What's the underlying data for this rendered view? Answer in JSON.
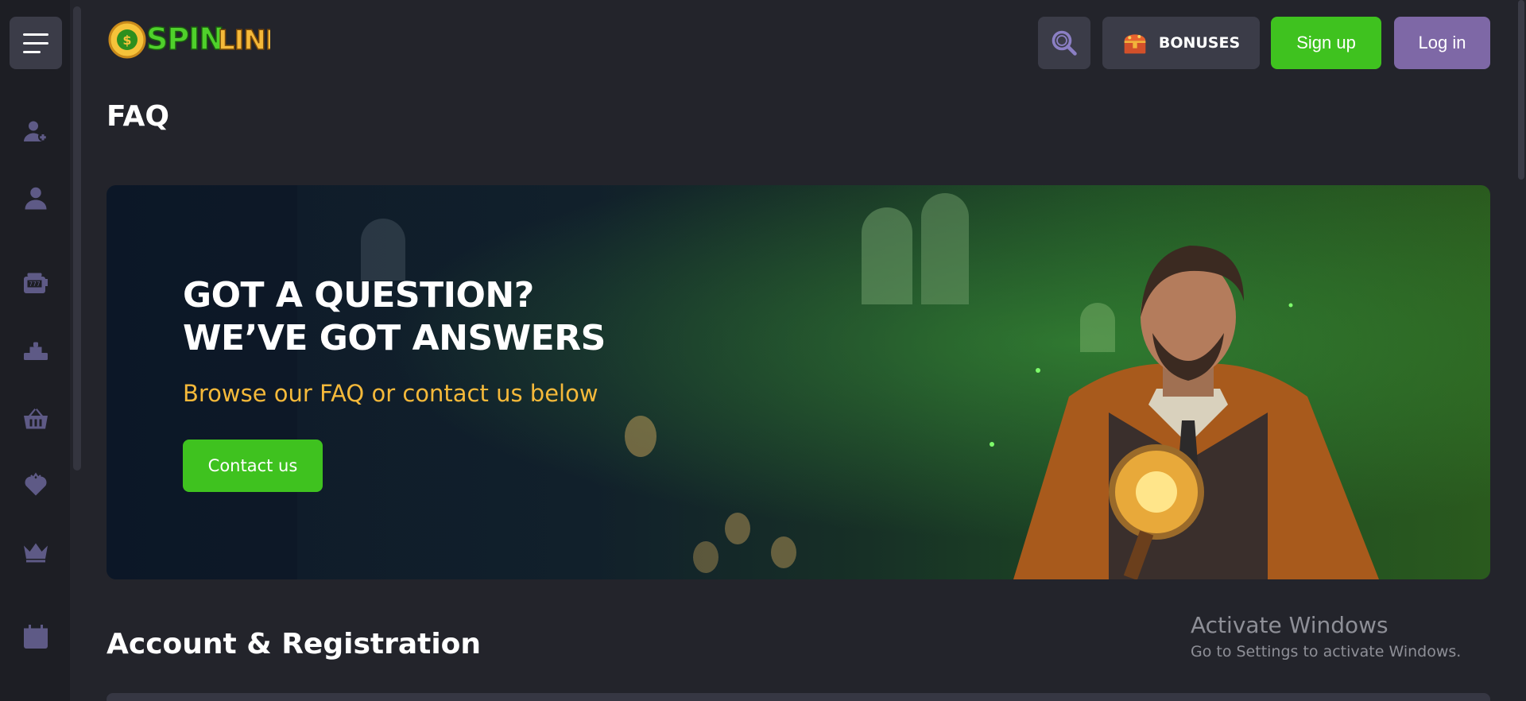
{
  "header": {
    "logo_text": "SPINLINE",
    "bonuses_label": "BONUSES",
    "signup_label": "Sign up",
    "login_label": "Log in"
  },
  "sidebar": {
    "icons": [
      "user-plus-icon",
      "user-icon",
      "slot-machine-icon",
      "live-casino-icon",
      "basket-icon",
      "heart-icon",
      "crown-icon",
      "calendar-icon"
    ]
  },
  "page": {
    "title": "FAQ"
  },
  "hero": {
    "headline_line1": "GOT A QUESTION?",
    "headline_line2": "WE’VE GOT ANSWERS",
    "subtitle": "Browse our FAQ or contact us below",
    "cta_label": "Contact us"
  },
  "sections": {
    "first_title": "Account & Registration"
  },
  "watermark": {
    "title": "Activate Windows",
    "subtitle": "Go to Settings to activate Windows."
  },
  "colors": {
    "accent_green": "#3fc21f",
    "accent_purple": "#7e68a6",
    "highlight_yellow": "#f5b93a",
    "background": "#23242b"
  }
}
